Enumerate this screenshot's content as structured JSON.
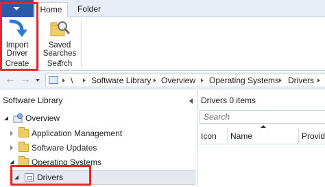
{
  "tabs": {
    "home": "Home",
    "folder": "Folder"
  },
  "ribbon": {
    "import_driver": {
      "line1": "Import",
      "line2": "Driver"
    },
    "saved_searches": {
      "line1": "Saved",
      "line2": "Searches"
    },
    "groups": {
      "create": "Create",
      "search": "Search"
    }
  },
  "address_bar": {
    "root": "\\",
    "crumbs": [
      "Software Library",
      "Overview",
      "Operating Systems",
      "Drivers"
    ]
  },
  "nav": {
    "header": "Software Library",
    "overview": "Overview",
    "items": [
      "Application Management",
      "Software Updates",
      "Operating Systems"
    ],
    "selected": "Drivers"
  },
  "content": {
    "title": "Drivers 0 items",
    "search_placeholder": "Search",
    "columns": [
      "Icon",
      "Name",
      "Provide"
    ]
  },
  "colors": {
    "app_menu": "#2c5aa8",
    "highlight": "#e8262b",
    "folder": "#f1cd64"
  }
}
